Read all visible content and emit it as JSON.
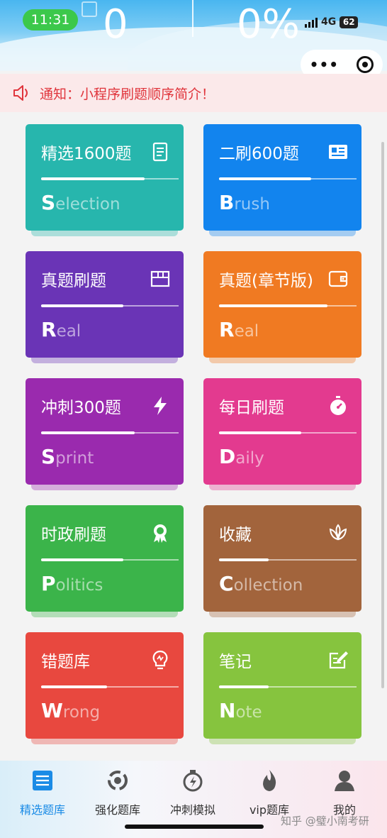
{
  "status_bar": {
    "time": "11:31",
    "network": "4G",
    "battery": "62"
  },
  "header": {
    "count_left": "0",
    "count_right": "0%"
  },
  "notice": {
    "text": "通知：小程序刷题顺序简介！",
    "color": "#e0353c"
  },
  "cards": [
    {
      "title": "精选1600题",
      "sub_initial": "S",
      "sub_rest": "election",
      "icon": "document-icon",
      "color": "#27b6ad",
      "progress": 0.75
    },
    {
      "title": "二刷600题",
      "sub_initial": "B",
      "sub_rest": "rush",
      "icon": "id-card-icon",
      "color": "#1284ee",
      "progress": 0.67
    },
    {
      "title": "真题刷题",
      "sub_initial": "R",
      "sub_rest": "eal",
      "icon": "grid-box-icon",
      "color": "#6a34b6",
      "progress": 0.6
    },
    {
      "title": "真题(章节版)",
      "sub_initial": "R",
      "sub_rest": "eal",
      "icon": "wallet-icon",
      "color": "#f07a22",
      "progress": 0.79
    },
    {
      "title": "冲刺300题",
      "sub_initial": "S",
      "sub_rest": "print",
      "icon": "lightning-icon",
      "color": "#9a2aae",
      "progress": 0.68
    },
    {
      "title": "每日刷题",
      "sub_initial": "D",
      "sub_rest": "aily",
      "icon": "stopwatch-icon",
      "color": "#e33a8f",
      "progress": 0.6
    },
    {
      "title": "时政刷题",
      "sub_initial": "P",
      "sub_rest": "olitics",
      "icon": "award-icon",
      "color": "#3bb44a",
      "progress": 0.6
    },
    {
      "title": "收藏",
      "sub_initial": "C",
      "sub_rest": "ollection",
      "icon": "lotus-icon",
      "color": "#a2643c",
      "progress": 0.36
    },
    {
      "title": "错题库",
      "sub_initial": "W",
      "sub_rest": "rong",
      "icon": "lightbulb-icon",
      "color": "#e8483f",
      "progress": 0.48
    },
    {
      "title": "笔记",
      "sub_initial": "N",
      "sub_rest": "ote",
      "icon": "edit-note-icon",
      "color": "#86c43e",
      "progress": 0.36
    }
  ],
  "nav": [
    {
      "label": "精选题库",
      "icon": "list-icon",
      "active": true
    },
    {
      "label": "强化题库",
      "icon": "circle-arrows-icon",
      "active": false
    },
    {
      "label": "冲刺模拟",
      "icon": "timer-icon",
      "active": false
    },
    {
      "label": "vip题库",
      "icon": "fire-icon",
      "active": false
    },
    {
      "label": "我的",
      "icon": "user-icon",
      "active": false
    }
  ],
  "watermark": "知乎 @璧小南考研",
  "colors": {
    "active_nav": "#1a8be6",
    "inactive_nav": "#555555"
  }
}
